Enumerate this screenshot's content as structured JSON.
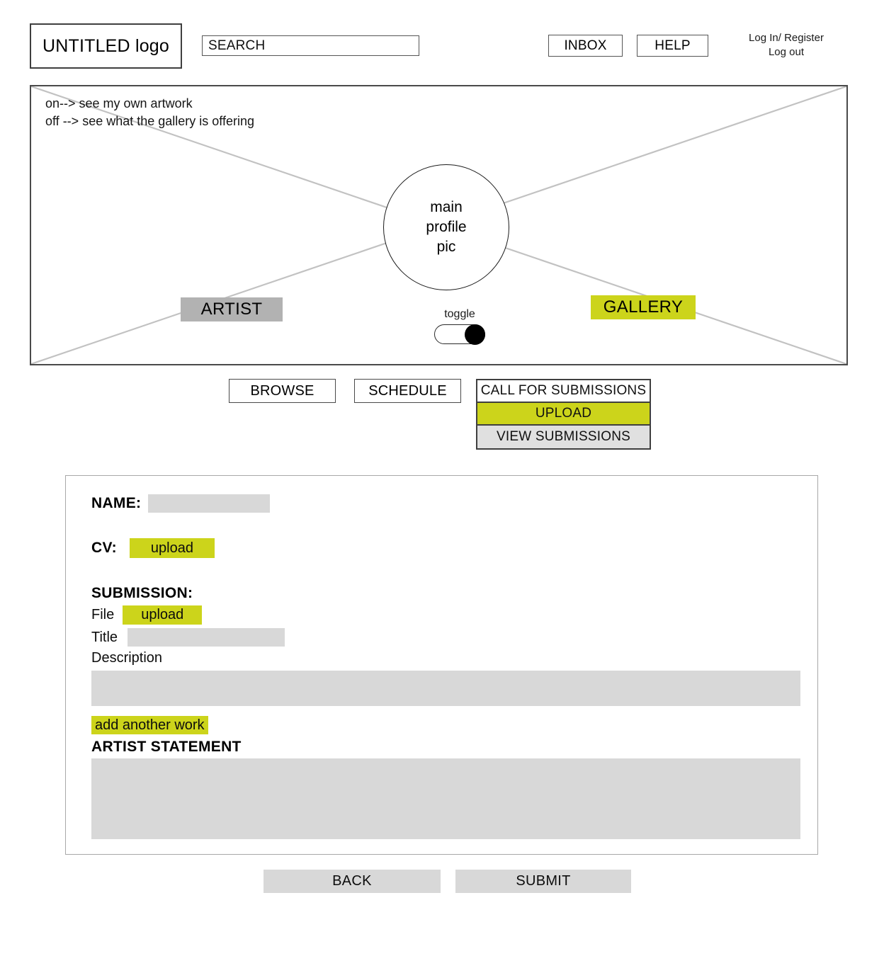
{
  "header": {
    "logo": "UNTITLED logo",
    "search_placeholder": "SEARCH",
    "search_value": "SEARCH",
    "inbox_label": "INBOX",
    "help_label": "HELP",
    "account_line1": "Log In/ Register",
    "account_line2": "Log out"
  },
  "banner": {
    "note_line1": "on--> see my own artwork",
    "note_line2": "off --> see what the gallery is offering",
    "profile_line1": "main",
    "profile_line2": "profile",
    "profile_line3": "pic",
    "artist_label": "ARTIST",
    "gallery_label": "GALLERY",
    "toggle_label": "toggle",
    "toggle_state": "on"
  },
  "nav": {
    "browse_label": "BROWSE",
    "schedule_label": "SCHEDULE",
    "dropdown": {
      "head_label": "CALL FOR SUBMISSIONS",
      "upload_label": "UPLOAD",
      "view_submissions_label": "VIEW SUBMISSIONS"
    }
  },
  "form": {
    "name_label": "NAME:",
    "name_value": "",
    "cv_label": "CV:",
    "cv_upload_label": "upload",
    "submission_label": "SUBMISSION:",
    "file_label": "File",
    "file_upload_label": "upload",
    "title_label": "Title",
    "title_value": "",
    "description_label": "Description",
    "description_value": "",
    "add_another_label": "add another work",
    "statement_label": "ARTIST STATEMENT",
    "statement_value": ""
  },
  "footer": {
    "back_label": "BACK",
    "submit_label": "SUBMIT"
  },
  "colors": {
    "highlight": "#ccd41b",
    "field_gray": "#d8d8d8",
    "artist_gray": "#b2b2b2",
    "view_gray": "#e0e0e0",
    "line": "#4a4a4a"
  }
}
